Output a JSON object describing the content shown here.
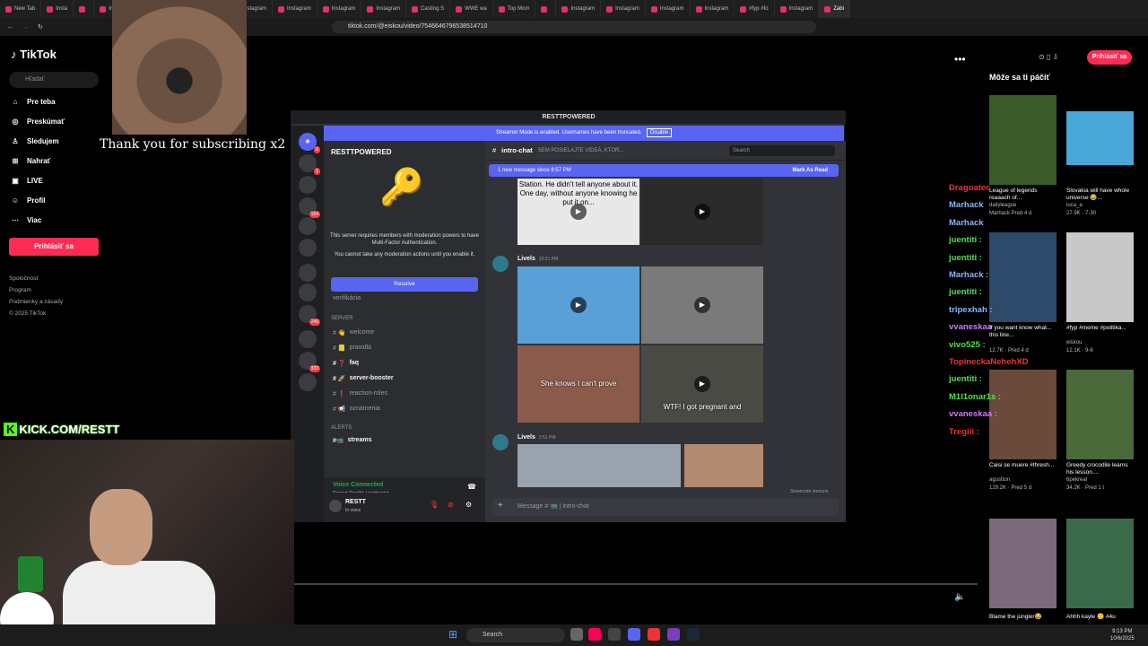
{
  "browser": {
    "tabs": [
      "New Tab",
      "Insta",
      "",
      "Instagram",
      "Instagram",
      "Instagram",
      "Instagram",
      "Instagram",
      "Instagram",
      "Instagram",
      "Casting S",
      "WWE wa",
      "Top Mom",
      "",
      "Instagram",
      "Instagram",
      "Instagram",
      "Instagram",
      "#fyp #fo",
      "Instagram",
      "Zabi"
    ],
    "url": "tiktok.com/@eiskou/video/7546646796538514710"
  },
  "tiktok": {
    "logo": "TikTok",
    "search_placeholder": "Hľadať",
    "nav": [
      {
        "label": "Pre teba",
        "icon": "home-icon",
        "glyph": "⌂"
      },
      {
        "label": "Preskúmať",
        "icon": "compass-icon",
        "glyph": "◎"
      },
      {
        "label": "Sledujem",
        "icon": "user-icon",
        "glyph": "♙"
      },
      {
        "label": "Nahrať",
        "icon": "upload-icon",
        "glyph": "⊞"
      },
      {
        "label": "LIVE",
        "icon": "live-icon",
        "glyph": "▣"
      },
      {
        "label": "Profil",
        "icon": "profile-icon",
        "glyph": "☺"
      },
      {
        "label": "Viac",
        "icon": "more-icon",
        "glyph": "⋯"
      }
    ],
    "login": "Prihlásiť sa",
    "footer": [
      "Spoločnosť",
      "Program",
      "Podmienky a zásady",
      "© 2025 TikTok"
    ],
    "may_like": "Môže sa ti páčiť",
    "login_right": "Prihlásiť sa",
    "videos": [
      {
        "caption": "League of legends reaaach of...",
        "author": "dailyleague",
        "meta": "Marhack  Pred 4 d",
        "thumb": "#3b5a2a"
      },
      {
        "caption": "Slovakia will have whole universe 😂...",
        "author": "luca_a",
        "meta": "27.9K · 7-30",
        "thumb": "#49a7d8"
      },
      {
        "caption": "If you want know what... this line...",
        "author": "",
        "meta": "12.7K · Pred 4 d",
        "thumb": "#2e4a6a"
      },
      {
        "caption": "#fyp #meme #politika...",
        "author": "eiskou",
        "meta": "12.1K · 9-6",
        "thumb": "#c8c8c8"
      },
      {
        "caption": "Caisi se muere #thresh...",
        "author": "agustton",
        "meta": "129.2K · Pred 5 d",
        "thumb": "#6a4a3a"
      },
      {
        "caption": "Greedy crocodile learns his lesson....",
        "author": "6pekreal",
        "meta": "34.2K · Pred 1 t",
        "thumb": "#4a6a3a"
      },
      {
        "caption": "Blame the jungler😂",
        "author": "",
        "meta": "",
        "thumb": "#7a6a7a"
      },
      {
        "caption": "Ahhh kayle 🙂 #4u",
        "author": "",
        "meta": "",
        "thumb": "#3a6a4a"
      }
    ]
  },
  "stream": {
    "thanks": "Thank you for subscribing x2",
    "kick_label": "KICK.COM/RESTT",
    "chat": [
      {
        "name": "Dragoatec",
        "color": "#e33"
      },
      {
        "name": "Marhack",
        "color": "#8ab4f8"
      },
      {
        "name": "Marhack",
        "color": "#8ab4f8"
      },
      {
        "name": "juentiti :",
        "color": "#4fe04f"
      },
      {
        "name": "juentiti :",
        "color": "#4fe04f"
      },
      {
        "name": "Marhack :",
        "color": "#8ab4f8"
      },
      {
        "name": "juentiti :",
        "color": "#4fe04f"
      },
      {
        "name": "tripexhah :",
        "color": "#8ab4f8"
      },
      {
        "name": "vvaneskaa",
        "color": "#d07aff"
      },
      {
        "name": "vivo525 :",
        "color": "#4fe04f"
      },
      {
        "name": "TopineckaNehehXD",
        "color": "#e33"
      },
      {
        "name": "juentiti :",
        "color": "#4fe04f"
      },
      {
        "name": "M1l1onar1s :",
        "color": "#4fe04f"
      },
      {
        "name": "vvaneskaa :",
        "color": "#d07aff"
      },
      {
        "name": "Tregiii :",
        "color": "#e33"
      }
    ]
  },
  "discord": {
    "window_title": "RESTTPOWERED",
    "streamer_banner": "Streamer Mode is enabled. Usernames have been truncated.",
    "disable": "Disable",
    "server_name": "RESTTPOWERED",
    "mfa_text_1": "This server requires members with moderation powers to have Multi-Factor Authentication.",
    "mfa_text_2": "You cannot take any moderation actions until you enable it.",
    "resolve": "Resolve",
    "verification": "verifikácia",
    "server_cat": "SERVER",
    "channels": [
      {
        "name": "welcome",
        "emoji": "👋",
        "bold": false
      },
      {
        "name": "pravidlá",
        "emoji": "📒",
        "bold": false
      },
      {
        "name": "faq",
        "emoji": "❓",
        "bold": true
      },
      {
        "name": "server-booster",
        "emoji": "🚀",
        "bold": true
      },
      {
        "name": "reaction-roles",
        "emoji": "❗",
        "bold": false
      },
      {
        "name": "oznámenia",
        "emoji": "📢",
        "bold": false
      }
    ],
    "alerts_cat": "ALERTS",
    "streams": "streams",
    "voice_connected": "Voice Connected",
    "voice_sub": "Renays Trenčín / resttsecret",
    "user_name": "RESTT",
    "user_status": "In voice",
    "channel_header": "intro-chat",
    "channel_topic": "SEM POSIELAJTE VIDEÁ, KTOR...",
    "search_placeholder": "Search",
    "new_messages": "1 new message since 8:57 PM",
    "mark_read": "Mark As Read",
    "top_caption": "Station. He didn't tell anyone about it. One day, without anyone knowing he put it on...",
    "msg1_author": "Livels",
    "msg1_time": "10:21 PM",
    "caption_she": "She knows I can't prove",
    "caption_wtf": "WTF! I got pregnant and",
    "msg2_author": "Livels",
    "msg2_time": "2:51 PM",
    "slowmode": "Slowmode immune",
    "composer_placeholder": "Message # 📹 | intro-chat",
    "server_badges": [
      "6",
      "1",
      "164",
      "249",
      "333"
    ]
  },
  "taskbar": {
    "search": "Search",
    "time": "9:13 PM",
    "date": "10/6/2025"
  }
}
